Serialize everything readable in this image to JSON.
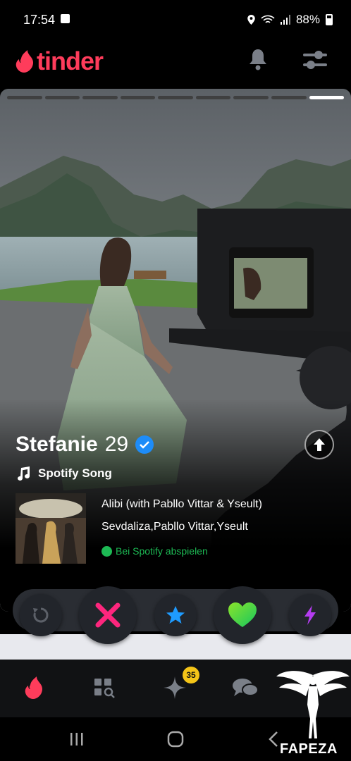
{
  "status_bar": {
    "time": "17:54",
    "battery": "88%"
  },
  "app": {
    "logo": "tinder",
    "brand_color": "#fe3c5b"
  },
  "card": {
    "photo_count": 9,
    "active_photo_index": 8,
    "name": "Stefanie",
    "age": "29",
    "verified": true,
    "anthem_label": "Spotify Song",
    "song": {
      "title": "Alibi (with Pabllo Vittar & Yseult)",
      "artists": "Sevdaliza,Pabllo Vittar,Yseult",
      "play_link": "Bei Spotify abspielen"
    }
  },
  "actions": {
    "rewind_icon": "rewind-icon",
    "nope_icon": "x-icon",
    "super_like_icon": "star-icon",
    "like_icon": "heart-icon",
    "boost_icon": "lightning-icon"
  },
  "bottom_nav": {
    "items": [
      "home-flame",
      "explore",
      "likes-you",
      "messages",
      "profile"
    ],
    "likes_badge": "35"
  },
  "watermark": {
    "text": "FAPEZA"
  }
}
